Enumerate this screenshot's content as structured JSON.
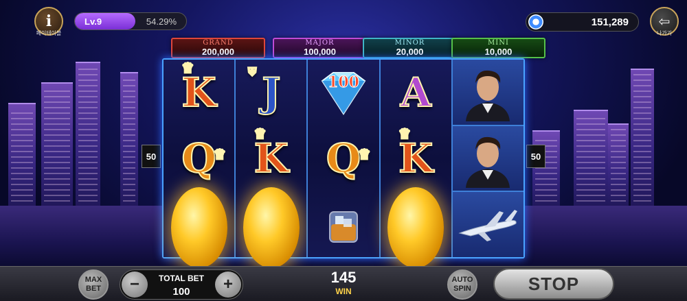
{
  "top_bar": {
    "info_label": "페이테이블",
    "level": "Lv.9",
    "level_percent": "54.29%",
    "level_progress": 0.5429,
    "coins": "151,289",
    "exit_label": "나가기"
  },
  "jackpots": [
    {
      "name": "GRAND",
      "value": "200,000",
      "color": "#e0463b"
    },
    {
      "name": "MAJOR",
      "value": "100,000",
      "color": "#c04bd8"
    },
    {
      "name": "MINOR",
      "value": "20,000",
      "color": "#3fb6c8"
    },
    {
      "name": "MINI",
      "value": "10,000",
      "color": "#56c24a"
    }
  ],
  "paylines": {
    "left": "50",
    "right": "50"
  },
  "reels": [
    {
      "symbols": [
        "K",
        "Q",
        "coin"
      ]
    },
    {
      "symbols": [
        "J",
        "K",
        "coin"
      ]
    },
    {
      "symbols": [
        "100",
        "Q",
        "whiskey-glass"
      ]
    },
    {
      "symbols": [
        "A",
        "K",
        "coin"
      ]
    },
    {
      "symbols": [
        "man-portrait",
        "man-portrait",
        "private-jet"
      ]
    }
  ],
  "diamond_value": "100",
  "bottom_bar": {
    "max_bet_line1": "MAX",
    "max_bet_line2": "BET",
    "total_bet_label": "TOTAL BET",
    "total_bet_value": "100",
    "minus": "−",
    "plus": "+",
    "win_value": "145",
    "win_label": "WIN",
    "auto_line1": "AUTO",
    "auto_line2": "SPIN",
    "stop_label": "STOP"
  },
  "letters": {
    "K": "K",
    "Q": "Q",
    "J": "J",
    "A": "A"
  }
}
